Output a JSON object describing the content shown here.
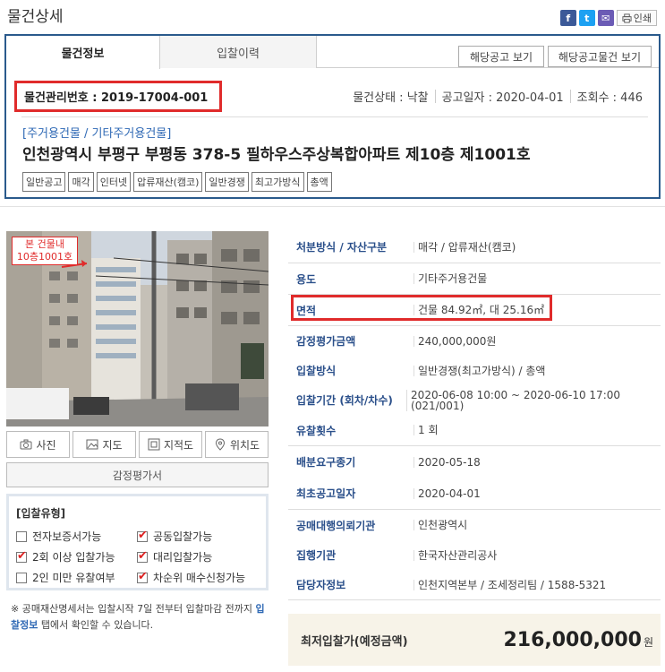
{
  "page_title": "물건상세",
  "share": {
    "facebook": "f",
    "twitter": "t",
    "mail": "✉",
    "print": "인쇄"
  },
  "tabs": [
    {
      "label": "물건정보"
    },
    {
      "label": "입찰이력"
    }
  ],
  "buttons": {
    "notice": "해당공고 보기",
    "notice_items": "해당공고물건 보기"
  },
  "management_no": "물건관리번호 : 2019-17004-001",
  "meta": {
    "status": "물건상태 : 낙찰",
    "notice_date": "공고일자 : 2020-04-01",
    "views": "조회수 : 446"
  },
  "category": "[주거용건물 / 기타주거용건물]",
  "address": "인천광역시 부평구 부평동 378-5 필하우스주상복합아파트 제10층 제1001호",
  "tags": [
    "일반공고",
    "매각",
    "인터넷",
    "압류재산(캠코)",
    "일반경쟁",
    "최고가방식",
    "총액"
  ],
  "photo_label": {
    "line1": "본 건물내",
    "line2": "10층1001호"
  },
  "photo_buttons": {
    "photo": "사진",
    "map": "지도",
    "cadastral": "지적도",
    "location": "위치도"
  },
  "appraisal_button": "감정평가서",
  "bid_type": {
    "title": "[입찰유형]",
    "options": [
      {
        "label": "전자보증서가능",
        "checked": false
      },
      {
        "label": "공동입찰가능",
        "checked": true
      },
      {
        "label": "2회 이상 입찰가능",
        "checked": true
      },
      {
        "label": "대리입찰가능",
        "checked": true
      },
      {
        "label": "2인 미만 유찰여부",
        "checked": false
      },
      {
        "label": "차순위 매수신청가능",
        "checked": true
      }
    ]
  },
  "note": {
    "part1": "※ 공매재산명세서는 입찰시작 7일 전부터 입찰마감 전까지 ",
    "link": "입찰정보",
    "part2": " 탭에서 확인할 수 있습니다."
  },
  "info": [
    {
      "label": "처분방식 / 자산구분",
      "value": "매각 / 압류재산(캠코)"
    },
    {
      "label": "용도",
      "value": "기타주거용건물"
    },
    {
      "label": "면적",
      "value": "건물 84.92㎡, 대 25.16㎡"
    },
    {
      "label": "감정평가금액",
      "value": "240,000,000원"
    },
    {
      "label": "입찰방식",
      "value": "일반경쟁(최고가방식) / 총액"
    },
    {
      "label": "입찰기간 (회차/차수)",
      "value": "2020-06-08 10:00 ~ 2020-06-10 17:00 (021/001)"
    },
    {
      "label": "유찰횟수",
      "value": "1 회"
    },
    {
      "label": "배분요구종기",
      "value": "2020-05-18"
    },
    {
      "label": "최초공고일자",
      "value": "2020-04-01"
    },
    {
      "label": "공매대행의뢰기관",
      "value": "인천광역시"
    },
    {
      "label": "집행기관",
      "value": "한국자산관리공사"
    },
    {
      "label": "담당자정보",
      "value": "인천지역본부 / 조세정리팀 / 1588-5321"
    }
  ],
  "min_bid": {
    "label": "최저입찰가(예정금액)",
    "value": "216,000,000",
    "unit": "원"
  }
}
